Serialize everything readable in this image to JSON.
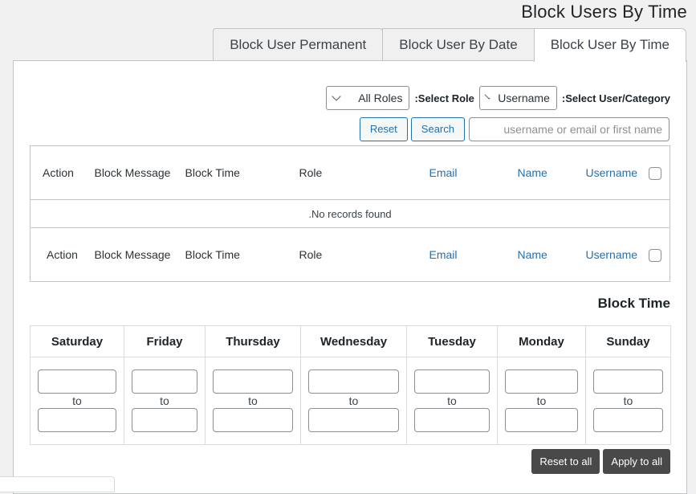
{
  "page": {
    "title": "Block Users By Time"
  },
  "tabs": [
    {
      "label": "Block User Permanent",
      "active": false
    },
    {
      "label": "Block User By Date",
      "active": false
    },
    {
      "label": "Block User By Time",
      "active": true
    }
  ],
  "filters": {
    "role_select": {
      "value": "All Roles",
      "label": ":Select Role"
    },
    "user_select": {
      "value": "Username",
      "label": ":Select User/Category"
    },
    "reset_label": "Reset",
    "search_label": "Search",
    "search_input": {
      "value": "",
      "placeholder": "username or email or first name"
    }
  },
  "users_table": {
    "columns": [
      {
        "label": "Action",
        "link": false
      },
      {
        "label": "Block Message",
        "link": false
      },
      {
        "label": "Block Time",
        "link": false
      },
      {
        "label": "Role",
        "link": false
      },
      {
        "label": "Email",
        "link": true
      },
      {
        "label": "Name",
        "link": true
      },
      {
        "label": "Username",
        "link": true
      }
    ],
    "empty_message": ".No records found",
    "select_all_checked": false
  },
  "block_time": {
    "title": "Block Time",
    "separator": "to",
    "days": [
      {
        "name": "Saturday",
        "from": "",
        "to": ""
      },
      {
        "name": "Friday",
        "from": "",
        "to": ""
      },
      {
        "name": "Thursday",
        "from": "",
        "to": ""
      },
      {
        "name": "Wednesday",
        "from": "",
        "to": ""
      },
      {
        "name": "Tuesday",
        "from": "",
        "to": ""
      },
      {
        "name": "Monday",
        "from": "",
        "to": ""
      },
      {
        "name": "Sunday",
        "from": "",
        "to": ""
      }
    ],
    "reset_all_label": "Reset to all",
    "apply_all_label": "Apply to all"
  },
  "colors": {
    "link": "#2271b1",
    "dark_button": "#494949",
    "background": "#f1f1f1"
  }
}
